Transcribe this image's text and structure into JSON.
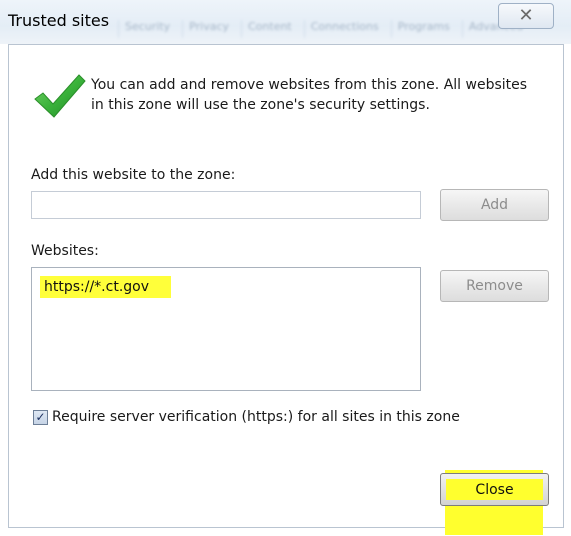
{
  "window": {
    "title": "Trusted sites",
    "close_glyph": "✕",
    "background_tabs": [
      "Security",
      "Privacy",
      "Content",
      "Connections",
      "Programs",
      "Advanced"
    ]
  },
  "info": {
    "icon": "checkmark-icon",
    "line1": "You can add and remove websites from this zone. All websites",
    "line2": "in this zone will use the zone's security settings."
  },
  "add_site": {
    "label": "Add this website to the zone:",
    "value": "",
    "placeholder": "",
    "add_button": "Add"
  },
  "websites": {
    "label": "Websites:",
    "items": [
      "https://*.ct.gov"
    ],
    "remove_button": "Remove"
  },
  "verification": {
    "label": "Require server verification (https:) for all sites in this zone",
    "checked": true
  },
  "footer": {
    "close_button": "Close"
  },
  "colors": {
    "highlight": "#ffff2e",
    "check_green": "#3bb33b"
  }
}
